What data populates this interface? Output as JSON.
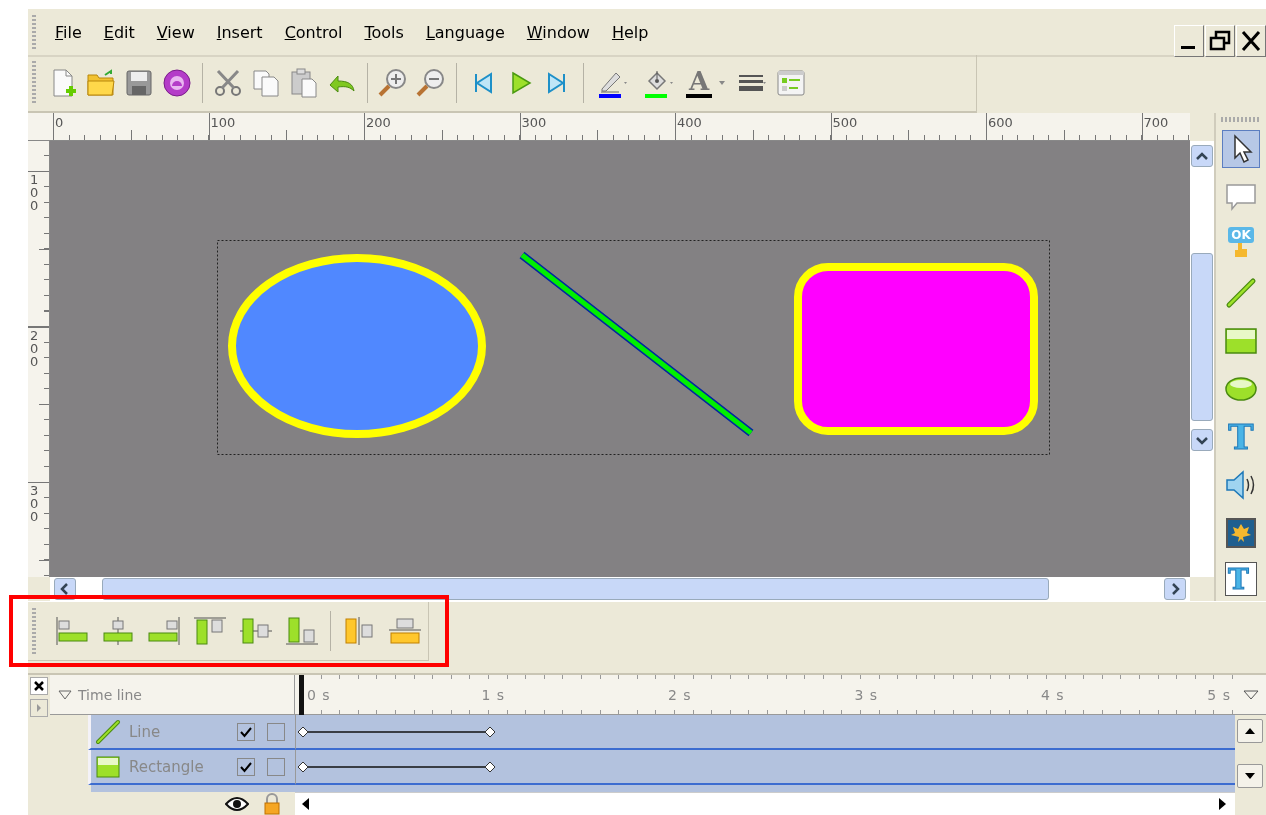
{
  "menu": [
    "File",
    "Edit",
    "View",
    "Insert",
    "Control",
    "Tools",
    "Language",
    "Window",
    "Help"
  ],
  "color_pickers": [
    {
      "kind": "line",
      "color": "#0000ff"
    },
    {
      "kind": "fill",
      "color": "#00ff00"
    },
    {
      "kind": "text",
      "glyph": "A",
      "color": "#000000"
    }
  ],
  "rulers": {
    "horizontal": [
      "0",
      "100",
      "200",
      "300",
      "400",
      "500",
      "600",
      "700"
    ],
    "vertical": [
      "100",
      "200",
      "300"
    ]
  },
  "canvas": {
    "group_selected": true,
    "shapes": [
      {
        "kind": "ellipse"
      },
      {
        "kind": "line"
      },
      {
        "kind": "rectangle"
      }
    ]
  },
  "tools": [
    {
      "kind": "pointer",
      "selected": true
    },
    {
      "kind": "callout",
      "selected": false
    },
    {
      "kind": "button",
      "glyph": "OK",
      "selected": false
    },
    {
      "kind": "line",
      "selected": false
    },
    {
      "kind": "rectangle",
      "selected": false
    },
    {
      "kind": "ellipse",
      "selected": false
    },
    {
      "kind": "text",
      "glyph": "T",
      "selected": false
    },
    {
      "kind": "sound",
      "selected": false
    },
    {
      "kind": "image",
      "selected": false
    },
    {
      "kind": "text-field",
      "glyph": "T",
      "selected": false
    }
  ],
  "timeline": {
    "title": "Time line",
    "ticks": [
      "0 s",
      "1 s",
      "2 s",
      "3 s",
      "4 s",
      "5 s"
    ],
    "layers": [
      {
        "name": "Line",
        "kind": "line",
        "visible": true,
        "locked": false
      },
      {
        "name": "Rectangle",
        "kind": "rectangle",
        "visible": true,
        "locked": false
      }
    ]
  },
  "highlight": true
}
